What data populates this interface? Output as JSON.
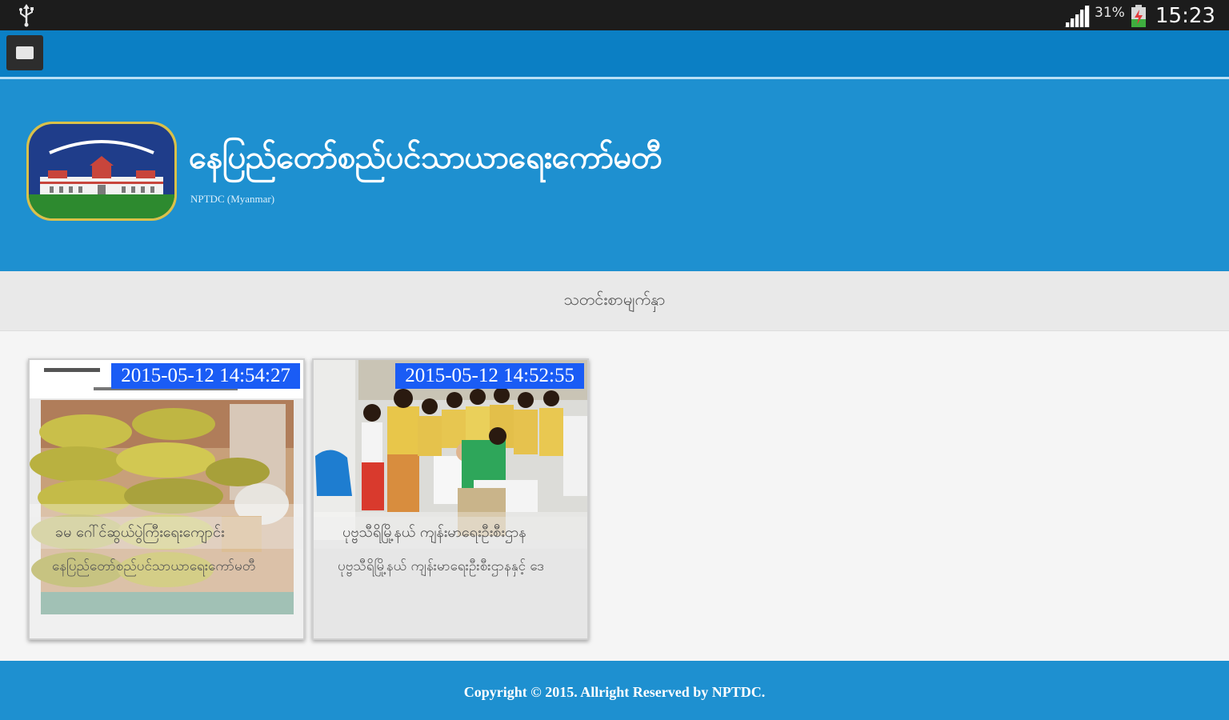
{
  "status_bar": {
    "usb_icon": "usb-icon",
    "signal_icon": "cell-signal-icon",
    "battery_percent": "31%",
    "battery_icon": "battery-charging-icon",
    "time": "15:23"
  },
  "action_bar": {
    "menu_icon": "menu-icon",
    "color": "#0b7fc4"
  },
  "header": {
    "title": "နေပြည်တော်စည်ပင်သာယာရေးကော်မတီ",
    "subtitle": "NPTDC (Myanmar)",
    "logo_icon": "nptdc-emblem-logo",
    "color": "#1e90d0"
  },
  "section": {
    "title": "သတင်းစာမျက်နှာ"
  },
  "news": [
    {
      "date": "2015-05-12 14:54:27",
      "headline": "ခမ ဂေါ်င်ဆွယ်ပွဲကြီးရေးကျောင်း",
      "description": "နေပြည်တော်စည်ပင်သာယာရေးကော်မတီ",
      "image": "rice-sacks-photo"
    },
    {
      "date": "2015-05-12 14:52:55",
      "headline": "ပုဗ္ဗသီရိမြို့နယ် ကျန်းမာရေးဦးစီးဌာန",
      "description": "ပုဗ္ဗသီရိမြို့နယ် ကျန်းမာရေးဦးစီးဌာနနှင့် ဒေ",
      "image": "health-staff-group-photo"
    }
  ],
  "footer": {
    "copyright": "Copyright © 2015. Allright Reserved by NPTDC."
  }
}
